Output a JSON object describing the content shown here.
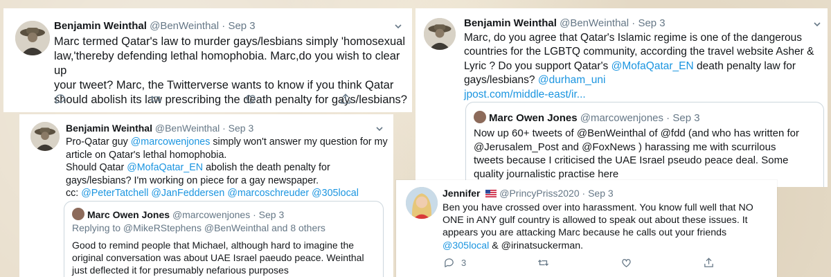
{
  "tweet1": {
    "name": "Benjamin Weinthal",
    "handle": "@BenWeinthal",
    "dot": "·",
    "date": "Sep 3",
    "line1": "Marc termed Qatar's law to murder gays/lesbians simply 'homosexual",
    "line2": "law,'thereby defending lethal homophobia. Marc,do you wish to clear up",
    "line3": "your tweet? Marc, the Twitterverse wants to know if you think Qatar",
    "line4": "should abolish its law prescribing the death penalty for gays/lesbians?"
  },
  "tweet2": {
    "name": "Benjamin Weinthal",
    "handle": "@BenWeinthal",
    "dot": "·",
    "date": "Sep 3",
    "l1a": "Pro-Qatar guy ",
    "l1link": "@marcowenjones",
    "l1b": " simply won't answer my question for my",
    "l2": "article on Qatar's lethal homophobia.",
    "l3a": "Should Qatar ",
    "l3link": "@MofaQatar_EN",
    "l3b": " abolish the death penalty for",
    "l4": "gays/lesbians? I'm working on piece for a gay newspaper.",
    "l5a": "cc: ",
    "cc1": "@PeterTatchell",
    "cc2": "@JanFeddersen",
    "cc3": "@marcoschreuder",
    "cc4": "@305local",
    "quote": {
      "name": "Marc Owen Jones",
      "handle": "@marcowenjones",
      "dot": "·",
      "date": "Sep 3",
      "reply": "Replying to @MikeRStephens @BenWeinthal and 8 others",
      "q1": "Good to remind people that Michael, although hard to imagine the",
      "q2": "original conversation was about UAE Israel paeudo peace. Weinthal",
      "q3": "just deflected it for presumably nefarious purposes"
    }
  },
  "tweet3": {
    "name": "Benjamin Weinthal",
    "handle": "@BenWeinthal",
    "dot": "·",
    "date": "Sep 3",
    "l1": "Marc, do you agree that Qatar's Islamic regime is one of the dangerous",
    "l2": "countries for the LGBTQ community, according the travel website Asher &",
    "l3a": "Lyric ? Do you support Qatar's ",
    "l3link": "@MofaQatar_EN",
    "l3b": " death penalty law for",
    "l4a": "gays/lesbians? ",
    "l4link": "@durham_uni",
    "l5link": "jpost.com/middle-east/ir...",
    "quote": {
      "name": "Marc Owen Jones",
      "handle": "@marcowenjones",
      "dot": "·",
      "date": "Sep 3",
      "q1": "Now up 60+ tweets of @BenWeinthal of @fdd (and who has written for",
      "q2": "@Jerusalem_Post and @FoxNews ) harassing me with scurrilous",
      "q3": "tweets because I criticised the UAE Israel pseudo peace deal. Some",
      "q4": "quality journalistic practise here"
    }
  },
  "tweet4": {
    "name": "Jennifer",
    "handle": "@PrincyPriss2020",
    "dot": "·",
    "date": "Sep 3",
    "l1": "Ben you have crossed over into harassment. You know full well that NO",
    "l2": "ONE in ANY gulf country is allowed to speak out about these issues. It",
    "l3": "appears you are attacking Marc because he calls out your friends",
    "l4link": "@305local",
    "l4b": " & @irinatsuckerman.",
    "reply_count": "3"
  },
  "icons": [
    "reply-icon",
    "retweet-icon",
    "like-icon",
    "share-icon",
    "chevron-down-icon",
    "us-flag-icon"
  ],
  "colors": {
    "link": "#1b95e0",
    "meta": "#657786",
    "text": "#14171a",
    "border": "#ccd6dd"
  }
}
